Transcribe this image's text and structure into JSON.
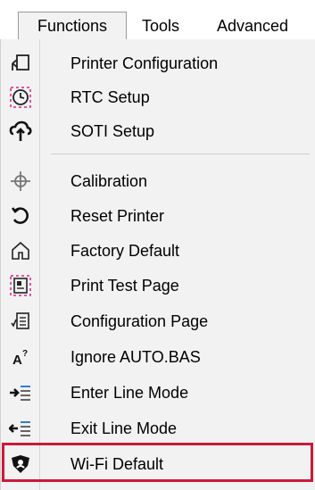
{
  "menubar": {
    "functions_label": "Functions",
    "tools_label": "Tools",
    "advanced_label": "Advanced"
  },
  "menu": {
    "items": [
      {
        "label": "Printer Configuration",
        "icon": "printer-config-icon"
      },
      {
        "label": "RTC Setup",
        "icon": "clock-icon"
      },
      {
        "label": "SOTI Setup",
        "icon": "cloud-upload-icon"
      },
      {
        "label": "Calibration",
        "icon": "crosshair-icon"
      },
      {
        "label": "Reset Printer",
        "icon": "reset-icon"
      },
      {
        "label": "Factory Default",
        "icon": "home-icon"
      },
      {
        "label": "Print Test Page",
        "icon": "print-test-page-icon"
      },
      {
        "label": "Configuration Page",
        "icon": "configuration-page-icon"
      },
      {
        "label": "Ignore AUTO.BAS",
        "icon": "ignore-auto-bas-icon"
      },
      {
        "label": "Enter Line Mode",
        "icon": "enter-line-mode-icon"
      },
      {
        "label": "Exit Line Mode",
        "icon": "exit-line-mode-icon"
      },
      {
        "label": "Wi-Fi Default",
        "icon": "wifi-shield-icon"
      }
    ],
    "highlighted_item": "Wi-Fi Default"
  },
  "colors": {
    "highlight_border": "#cc1a3a",
    "menu_background": "#f2f2f2",
    "icon_accent": "#e0208a"
  }
}
